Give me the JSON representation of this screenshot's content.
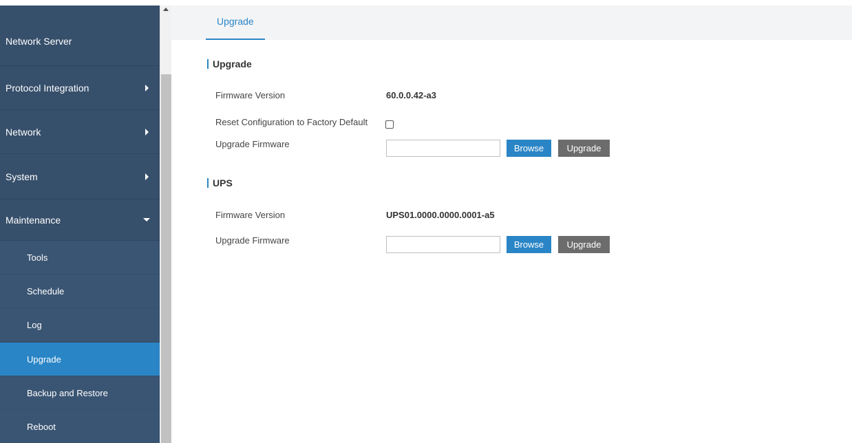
{
  "sidebar": {
    "items": [
      {
        "label": "Network Server"
      },
      {
        "label": "Protocol Integration"
      },
      {
        "label": "Network"
      },
      {
        "label": "System"
      },
      {
        "label": "Maintenance"
      }
    ],
    "subitems": [
      {
        "label": "Tools"
      },
      {
        "label": "Schedule"
      },
      {
        "label": "Log"
      },
      {
        "label": "Upgrade"
      },
      {
        "label": "Backup and Restore"
      },
      {
        "label": "Reboot"
      }
    ],
    "active": "Upgrade"
  },
  "tabs": [
    {
      "label": "Upgrade"
    }
  ],
  "sections": [
    {
      "title": "Upgrade",
      "firmware_label": "Firmware Version",
      "firmware_value": "60.0.0.42-a3",
      "reset_label": "Reset Configuration to Factory Default",
      "reset_checked": false,
      "upgrade_label": "Upgrade Firmware",
      "browse_label": "Browse",
      "upgrade_button": "Upgrade"
    },
    {
      "title": "UPS",
      "firmware_label": "Firmware Version",
      "firmware_value": "UPS01.0000.0000.0001-a5",
      "upgrade_label": "Upgrade Firmware",
      "browse_label": "Browse",
      "upgrade_button": "Upgrade"
    }
  ],
  "colors": {
    "sidebar_bg": "#364f6b",
    "active_bg": "#2a85c6",
    "accent": "#2a85c6",
    "upgrade_btn": "#6c6c6c"
  }
}
